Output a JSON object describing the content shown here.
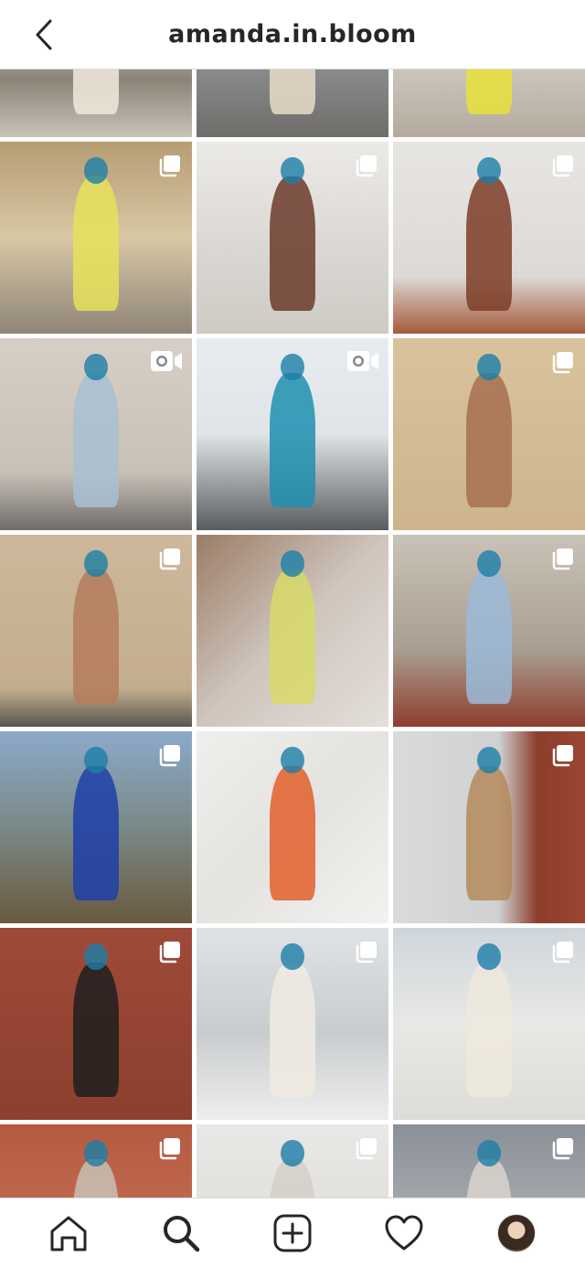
{
  "header": {
    "title": "amanda.in.bloom",
    "back_icon": "chevron-left-icon"
  },
  "grid": {
    "tiles": [
      {
        "badge": "none",
        "bg": "linear-gradient(180deg,#b9c6cf 0%,#c7c0b4 45%,#8a8477 70%,#c9c2b8 100%)",
        "figure": "#f1e9dc"
      },
      {
        "badge": "none",
        "bg": "linear-gradient(180deg,#b9c2cb 0%,#9aa0a2 40%,#6f6d6a 100%)",
        "figure": "#e8dcc8"
      },
      {
        "badge": "none",
        "bg": "linear-gradient(180deg,#d9d3cc 0%,#cfc8be 60%,#b4ab9e 100%)",
        "figure": "#e8e23a"
      },
      {
        "badge": "carousel",
        "bg": "linear-gradient(180deg,#b79d72 0%,#d8c7a5 50%,#8f8578 100%)",
        "figure": "#e6e25b"
      },
      {
        "badge": "carousel",
        "bg": "linear-gradient(180deg,#eceae7 0%,#d9d6d2 60%,#cfcac4 100%)",
        "figure": "#6b3b2c"
      },
      {
        "badge": "carousel",
        "bg": "linear-gradient(180deg,#e7e5e2 0%,#dddad6 70%,#a55a3c 100%)",
        "figure": "#7c3d27"
      },
      {
        "badge": "video",
        "bg": "linear-gradient(180deg,#d7cfc6 0%,#c9c0b6 70%,#6f6d6a 100%)",
        "figure": "#a8bfd2"
      },
      {
        "badge": "video",
        "bg": "linear-gradient(180deg,#e8ecef 0%,#dfe4e7 50%,#5a5d60 100%)",
        "figure": "#1e8fb0"
      },
      {
        "badge": "carousel",
        "bg": "linear-gradient(180deg,#d9c39d 0%,#cdb48c 100%)",
        "figure": "#a7704f"
      },
      {
        "badge": "carousel",
        "bg": "linear-gradient(180deg,#cdb89b 0%,#c4ad8f 80%,#5a5650 100%)",
        "figure": "#b57c5a"
      },
      {
        "badge": "none",
        "bg": "linear-gradient(135deg,#9c7d66 0%,#cfc5bd 50%,#e4dfda 100%)",
        "figure": "#d8d96a"
      },
      {
        "badge": "carousel",
        "bg": "linear-gradient(180deg,#c9c2b6 0%,#a99f91 60%,#8e3d2e 100%)",
        "figure": "#9bbad8"
      },
      {
        "badge": "carousel",
        "bg": "linear-gradient(180deg,#8ca9c9 0%,#7c8d8f 45%,#6a5a3e 100%)",
        "figure": "#1f3fa8"
      },
      {
        "badge": "none",
        "bg": "linear-gradient(135deg,#efefed 0%,#e4e3e0 50%,#f3f2f0 100%)",
        "figure": "#e25f2a"
      },
      {
        "badge": "carousel",
        "bg": "linear-gradient(90deg,#d8dadb 0%,#cfd1d2 55%,#8c3d2c 75%,#9a4632 100%)",
        "figure": "#b58a5c"
      },
      {
        "badge": "carousel",
        "bg": "linear-gradient(180deg,#9e4a38 0%,#8d3f2f 100%)",
        "figure": "#1f1f1f"
      },
      {
        "badge": "carousel",
        "bg": "linear-gradient(180deg,#dfe3e6 0%,#c9ccce 55%,#eeeeee 100%)",
        "figure": "#f0ebe2"
      },
      {
        "badge": "carousel",
        "bg": "linear-gradient(180deg,#cfd6db 0%,#e8e8e6 50%,#dedcd8 100%)",
        "figure": "#efe9dd"
      },
      {
        "badge": "carousel",
        "bg": "linear-gradient(180deg,#b55a41 0%,#cc7a5f 100%)",
        "figure": "#c9c0b6"
      },
      {
        "badge": "carousel",
        "bg": "linear-gradient(180deg,#e9e8e6 0%,#d8d6d2 100%)",
        "figure": "#d4cfc8"
      },
      {
        "badge": "carousel",
        "bg": "linear-gradient(180deg,#8a9097 0%,#c7c9cb 100%)",
        "figure": "#d9d4cc"
      }
    ]
  },
  "tabbar": {
    "items": [
      {
        "name": "home",
        "icon": "home-icon"
      },
      {
        "name": "search",
        "icon": "search-icon",
        "active": true
      },
      {
        "name": "new-post",
        "icon": "add-post-icon"
      },
      {
        "name": "activity",
        "icon": "heart-icon"
      },
      {
        "name": "profile",
        "icon": "profile-avatar"
      }
    ]
  },
  "colors": {
    "text": "#262626",
    "divider": "#dbdbdb",
    "background": "#ffffff"
  }
}
